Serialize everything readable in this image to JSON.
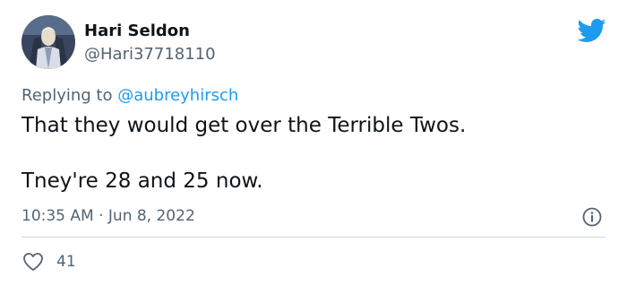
{
  "tweet": {
    "author": {
      "display_name": "Hari Seldon",
      "handle": "@Hari37718110",
      "avatar_icon": "avatar-hari-seldon"
    },
    "reply": {
      "prefix": "Replying to ",
      "mention": "@aubreyhirsch"
    },
    "text_lines": [
      "That they would get over the Terrible Twos.",
      "Tney're 28 and 25 now."
    ],
    "timestamp": "10:35 AM · Jun 8, 2022",
    "likes": "41"
  },
  "icons": {
    "brand": "twitter-bird-icon",
    "info": "info-icon",
    "like": "heart-icon"
  },
  "colors": {
    "brand_blue": "#1d9bf0",
    "text_primary": "#0f1419",
    "text_secondary": "#536471",
    "divider": "#cfd9de"
  }
}
